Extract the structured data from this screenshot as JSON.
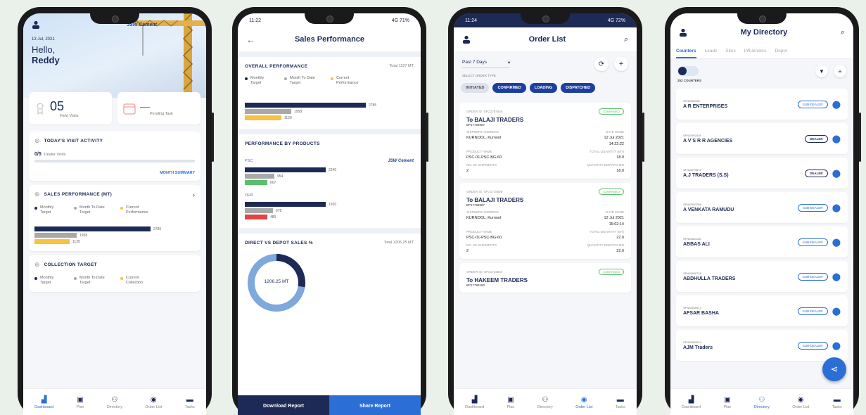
{
  "phone1": {
    "date": "13 Jul, 2021",
    "greeting": "Hello,",
    "name": "Reddy",
    "brand": "JSW Cement",
    "kpi1_value": "05",
    "kpi1_label": "Field Visits",
    "kpi2_value": "—",
    "kpi2_label": "Pending Task",
    "visit_title": "TODAY'S VISIT ACTIVITY",
    "visit_count": "0/5",
    "visit_label": "Dealer Visits",
    "month_summary": "MONTH SUMMARY",
    "sales_title": "SALES PERFORMANCE (MT)",
    "legend": [
      "Monthly Target",
      "Month To Date Target",
      "Current Performance"
    ],
    "bar_values": [
      "2785",
      "1958",
      "1120"
    ],
    "collection_title": "COLLECTION TARGET",
    "legend2": [
      "Monthly Target",
      "Month To Date Target",
      "Current Collection"
    ],
    "nav": [
      "Dashboard",
      "Plan",
      "Directory",
      "Order List",
      "Tasks"
    ]
  },
  "phone2": {
    "time": "11:22",
    "status": "4G 71%",
    "title": "Sales Performance",
    "overall_title": "OVERALL PERFORMANCE",
    "overall_total": "Total 1127 MT",
    "legend": [
      "Monthly Target",
      "Month To Date Target",
      "Current Performance"
    ],
    "overall_values": [
      "2785",
      "1958",
      "1120"
    ],
    "products_title": "PERFORMANCE BY PRODUCTS",
    "brand": "JSW Cement",
    "product1": "PSC",
    "product1_values": [
      "2240",
      "954",
      "607"
    ],
    "product2": "OHD",
    "product2_values": [
      "1920",
      "678",
      "480"
    ],
    "direct_title": "DIRECT VS DEPOT SALES %",
    "direct_total": "Total 1206.25 MT",
    "donut_label": "1206.25 MT",
    "download": "Download Report",
    "share": "Share Report"
  },
  "phone3": {
    "time": "11:24",
    "status": "4G 72%",
    "title": "Order List",
    "filter": "Past 7 Days",
    "select_label": "SELECT ORDER TYPE",
    "tabs": [
      "INITIATED",
      "CONFIRMED",
      "LOADING",
      "DISPATCHED"
    ],
    "orders": [
      {
        "id": "ORDER ID: SFO1797548",
        "to": "To BALAJI TRADERS",
        "code": "BP17798987",
        "status": "CONFIRMED",
        "addr_label": "SHIPMENT ADDRESS",
        "addr": "KURNOOL, Kurnool",
        "date_label": "DATE MADE",
        "date": "12 Jul 2021",
        "time": "14:22:22",
        "prod_label": "PRODUCT NAME",
        "prod": "PSC-01-PSC-BG-60",
        "qty_label": "TOTAL QUANTITY (MT)",
        "qty": "18.0",
        "bags_label": "NO. OF SHIPMENTS",
        "bags": "2",
        "disp_label": "QUANTITY DISPATCHED",
        "disp": "18.0"
      },
      {
        "id": "ORDER ID: SFO1715808",
        "to": "To BALAJI TRADERS",
        "code": "BP17798987",
        "status": "CONFIRMED",
        "addr_label": "SHIPMENT ADDRESS",
        "addr": "KURNOOL, Kurnool",
        "date_label": "DATE MADE",
        "date": "12 Jul 2021",
        "time": "15:02:14",
        "prod_label": "PRODUCT NAME",
        "prod": "PSC-01-PSC-BG-60",
        "qty_label": "TOTAL QUANTITY (MT)",
        "qty": "22.0",
        "bags_label": "NO. OF SHIPMENTS",
        "bags": "2",
        "disp_label": "QUANTITY DISPATCHED",
        "disp": "22.0"
      },
      {
        "id": "ORDER ID: SFO1715840",
        "to": "To HAKEEM TRADERS",
        "code": "BP17798160",
        "status": "CONFIRMED"
      }
    ],
    "nav": [
      "Dashboard",
      "Plan",
      "Directory",
      "Order List",
      "Tasks"
    ]
  },
  "phone4": {
    "title": "My Directory",
    "tabs": [
      "Counters",
      "Leads",
      "Sites",
      "Influencers",
      "Depot"
    ],
    "count": "252 COUNTERS",
    "items": [
      {
        "code": "SFN2569348",
        "name": "A R ENTERPRISES",
        "tag": "SUB-DEALER"
      },
      {
        "code": "SFN11902418",
        "name": "A V S R R AGENCIES",
        "tag": "DEALER"
      },
      {
        "code": "SFN11970873",
        "name": "A.J TRADERS (S.S)",
        "tag": "DEALER"
      },
      {
        "code": "SFN25643286",
        "name": "A VENKATA RAMUDU",
        "tag": "SUB-DEALER"
      },
      {
        "code": "SFN25651148",
        "name": "ABBAS ALI",
        "tag": "SUB-DEALER"
      },
      {
        "code": "SFN25650728",
        "name": "ABDHULLA TRADERS",
        "tag": "SUB-DEALER"
      },
      {
        "code": "SFN25630914",
        "name": "AFSAR BASHA",
        "tag": "SUB-DEALER"
      },
      {
        "code": "SFN25653244",
        "name": "AJM Traders",
        "tag": "SUB-DEALER"
      }
    ],
    "nav": [
      "Dashboard",
      "Plan",
      "Directory",
      "Order List",
      "Tasks"
    ]
  },
  "colors": {
    "navy": "#1c2a55",
    "blue": "#2b6fd6",
    "amber": "#f5c242",
    "grey": "#a9a9a9",
    "green": "#5cbf6c",
    "red": "#e04444"
  }
}
